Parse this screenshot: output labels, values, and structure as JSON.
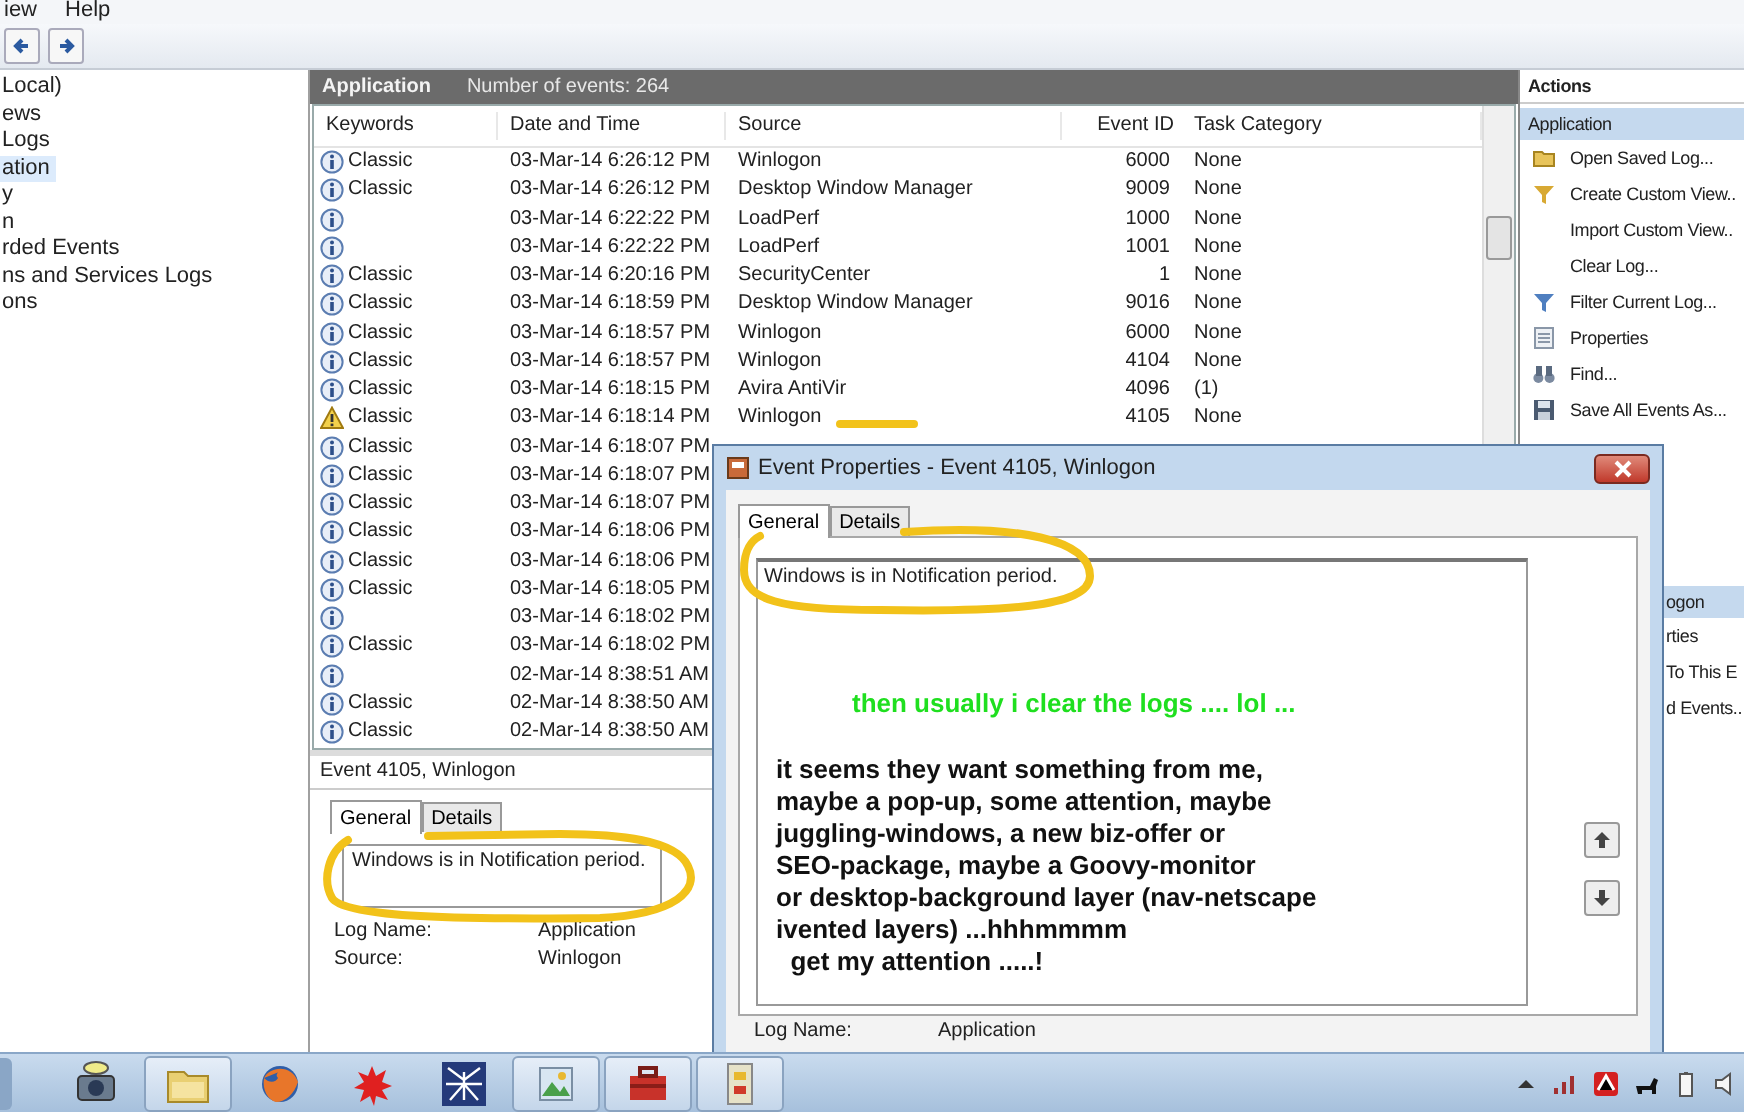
{
  "menu": [
    {
      "label": "iew"
    },
    {
      "label": "Help"
    }
  ],
  "tree": [
    {
      "label": "Local)",
      "selected": false,
      "children": [
        {
          "label": "ews",
          "selected": false
        },
        {
          "label": "Logs",
          "selected": false,
          "children": [
            {
              "label": "ation",
              "selected": true
            },
            {
              "label": "y",
              "selected": false
            },
            {
              "label": "n",
              "selected": false
            },
            {
              "label": "rded Events",
              "selected": false
            }
          ]
        },
        {
          "label": "ns and Services Logs",
          "selected": false
        },
        {
          "label": "ons",
          "selected": false
        }
      ]
    }
  ],
  "log_header": {
    "title": "Application",
    "count": "Number of events: 264"
  },
  "table": {
    "columns": [
      "Keywords",
      "Date and Time",
      "Source",
      "Event ID",
      "Task Category"
    ],
    "rows": [
      {
        "kind": "info",
        "keywords": "Classic",
        "date": "03-Mar-14 6:26:12 PM",
        "source": "Winlogon",
        "event_id": "6000",
        "task": "None"
      },
      {
        "kind": "info",
        "keywords": "Classic",
        "date": "03-Mar-14 6:26:12 PM",
        "source": "Desktop Window Manager",
        "event_id": "9009",
        "task": "None"
      },
      {
        "kind": "info",
        "date": "03-Mar-14 6:22:22 PM",
        "source": "LoadPerf",
        "event_id": "1000",
        "task": "None"
      },
      {
        "kind": "info",
        "date": "03-Mar-14 6:22:22 PM",
        "source": "LoadPerf",
        "event_id": "1001",
        "task": "None"
      },
      {
        "kind": "info",
        "keywords": "Classic",
        "date": "03-Mar-14 6:20:16 PM",
        "source": "SecurityCenter",
        "event_id": "1",
        "task": "None"
      },
      {
        "kind": "info",
        "keywords": "Classic",
        "date": "03-Mar-14 6:18:59 PM",
        "source": "Desktop Window Manager",
        "event_id": "9016",
        "task": "None"
      },
      {
        "kind": "info",
        "keywords": "Classic",
        "date": "03-Mar-14 6:18:57 PM",
        "source": "Winlogon",
        "event_id": "6000",
        "task": "None"
      },
      {
        "kind": "info",
        "keywords": "Classic",
        "date": "03-Mar-14 6:18:57 PM",
        "source": "Winlogon",
        "event_id": "4104",
        "task": "None"
      },
      {
        "kind": "info",
        "keywords": "Classic",
        "date": "03-Mar-14 6:18:15 PM",
        "source": "Avira AntiVir",
        "event_id": "4096",
        "task": "(1)"
      },
      {
        "kind": "warning",
        "keywords": "Classic",
        "date": "03-Mar-14 6:18:14 PM",
        "source": "Winlogon",
        "event_id": "4105",
        "task": "None"
      },
      {
        "kind": "info",
        "keywords": "Classic",
        "date": "03-Mar-14 6:18:07 PM"
      },
      {
        "kind": "info",
        "keywords": "Classic",
        "date": "03-Mar-14 6:18:07 PM"
      },
      {
        "kind": "info",
        "keywords": "Classic",
        "date": "03-Mar-14 6:18:07 PM"
      },
      {
        "kind": "info",
        "keywords": "Classic",
        "date": "03-Mar-14 6:18:06 PM"
      },
      {
        "kind": "info",
        "keywords": "Classic",
        "date": "03-Mar-14 6:18:06 PM"
      },
      {
        "kind": "info",
        "keywords": "Classic",
        "date": "03-Mar-14 6:18:05 PM"
      },
      {
        "kind": "info",
        "date": "03-Mar-14 6:18:02 PM"
      },
      {
        "kind": "info",
        "keywords": "Classic",
        "date": "03-Mar-14 6:18:02 PM"
      },
      {
        "kind": "info",
        "date": "02-Mar-14 8:38:51 AM"
      },
      {
        "kind": "info",
        "keywords": "Classic",
        "date": "02-Mar-14 8:38:50 AM"
      },
      {
        "kind": "info",
        "keywords": "Classic",
        "date": "02-Mar-14 8:38:50 AM"
      }
    ]
  },
  "preview": {
    "title": "Event 4105, Winlogon",
    "tabs": [
      {
        "label": "General",
        "selected": true
      },
      {
        "label": "Details",
        "selected": false
      }
    ],
    "message": "Windows is in Notification period.",
    "fields": [
      {
        "label": "Log Name:",
        "value": "Application"
      },
      {
        "label": "Source:",
        "value": "Winlogon"
      }
    ]
  },
  "actions": {
    "title": "Actions",
    "sections": [
      {
        "title": "Application",
        "items": [
          "Open Saved Log...",
          "Create Custom View..",
          "Import Custom View..",
          "Clear Log...",
          "Filter Current Log...",
          "Properties",
          "Find...",
          "Save All Events As..."
        ]
      },
      {
        "title": "ogon",
        "items": [
          "rties",
          "To This E",
          "d Events.."
        ]
      }
    ]
  },
  "dialog": {
    "title": "Event Properties - Event 4105, Winlogon",
    "tabs": [
      {
        "label": "General",
        "selected": true
      },
      {
        "label": "Details",
        "selected": false
      }
    ],
    "message": "Windows is in Notification period.",
    "note_green": "then usually i clear the logs .... lol ...",
    "note_lines": [
      "it seems they want something from me,",
      "maybe a pop-up, some attention, maybe",
      "juggling-windows, a new biz-offer or",
      "SEO-package, maybe a Goovy-monitor",
      "or desktop-background layer (nav-netscape",
      "ivented layers) ...hhhmmmm",
      "  get my attention .....!"
    ],
    "fields": [
      {
        "label": "Log Name:",
        "value": "Application"
      }
    ]
  },
  "taskbar": {
    "buttons": [
      {
        "open": false
      },
      {
        "open": true
      },
      {
        "open": false
      },
      {
        "open": false
      },
      {
        "open": false
      },
      {
        "open": true
      },
      {
        "open": true
      },
      {
        "open": true
      }
    ]
  }
}
